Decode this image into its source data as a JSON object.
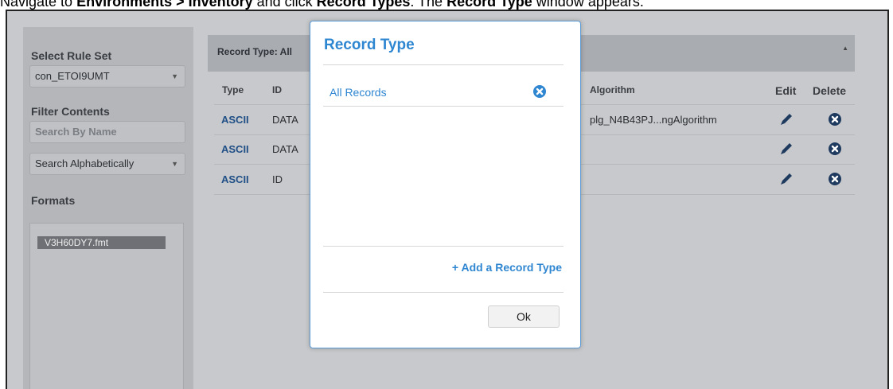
{
  "instruction": {
    "p1": "Navigate to ",
    "b1": "Environments > Inventory",
    "p2": " and click ",
    "b2": "Record Types",
    "p3": ". The ",
    "b3": "Record Type",
    "p4": " window appears."
  },
  "sidebar": {
    "select_rule_set_label": "Select Rule Set",
    "rule_set_value": "con_ETOI9UMT",
    "filter_contents_label": "Filter Contents",
    "search_placeholder": "Search By Name",
    "sort_value": "Search Alphabetically",
    "formats_label": "Formats",
    "formats": [
      "V3H60DY7.fmt"
    ]
  },
  "table": {
    "header_title": "Record Type: All",
    "columns": {
      "type": "Type",
      "id": "ID",
      "algorithm": "Algorithm",
      "edit": "Edit",
      "delete": "Delete"
    },
    "rows": [
      {
        "type": "ASCII",
        "id": "DATA",
        "algorithm": "plg_N4B43PJ...ngAlgorithm"
      },
      {
        "type": "ASCII",
        "id": "DATA",
        "algorithm": ""
      },
      {
        "type": "ASCII",
        "id": "ID",
        "algorithm": ""
      }
    ]
  },
  "modal": {
    "title": "Record Type",
    "records": [
      "All Records"
    ],
    "add_link": "+ Add a Record Type",
    "ok_label": "Ok"
  },
  "colors": {
    "accent": "#2f86d1",
    "link_dark": "#1f4f86",
    "icon_dark": "#1f3a5f"
  }
}
